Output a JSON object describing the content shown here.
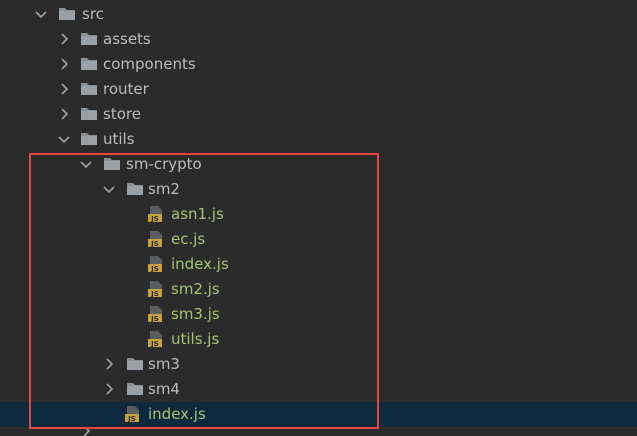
{
  "tree": {
    "rows": [
      {
        "label": "src",
        "kind": "folder",
        "expanded": true
      },
      {
        "label": "assets",
        "kind": "folder",
        "expanded": false
      },
      {
        "label": "components",
        "kind": "folder",
        "expanded": false
      },
      {
        "label": "router",
        "kind": "folder",
        "expanded": false
      },
      {
        "label": "store",
        "kind": "folder",
        "expanded": false
      },
      {
        "label": "utils",
        "kind": "folder",
        "expanded": true
      },
      {
        "label": "sm-crypto",
        "kind": "folder",
        "expanded": true
      },
      {
        "label": "sm2",
        "kind": "folder",
        "expanded": true
      },
      {
        "label": "asn1.js",
        "kind": "js-file"
      },
      {
        "label": "ec.js",
        "kind": "js-file"
      },
      {
        "label": "index.js",
        "kind": "js-file"
      },
      {
        "label": "sm2.js",
        "kind": "js-file"
      },
      {
        "label": "sm3.js",
        "kind": "js-file"
      },
      {
        "label": "utils.js",
        "kind": "js-file"
      },
      {
        "label": "sm3",
        "kind": "folder",
        "expanded": false
      },
      {
        "label": "sm4",
        "kind": "folder",
        "expanded": false
      },
      {
        "label": "index.js",
        "kind": "js-file",
        "selected": true
      }
    ],
    "file_badge_text": "JS"
  },
  "colors": {
    "background": "#2b2b2b",
    "selected_row": "#0d293e",
    "folder_text": "#bbbbbb",
    "js_text": "#a9c36f",
    "folder_icon": "#8a8f94",
    "js_badge": "#c7a23a",
    "highlight_border": "#e84644"
  },
  "icons": {
    "expand": "chevron-down-icon",
    "collapse": "chevron-right-icon",
    "folder": "folder-icon",
    "js_file": "javascript-file-icon"
  }
}
